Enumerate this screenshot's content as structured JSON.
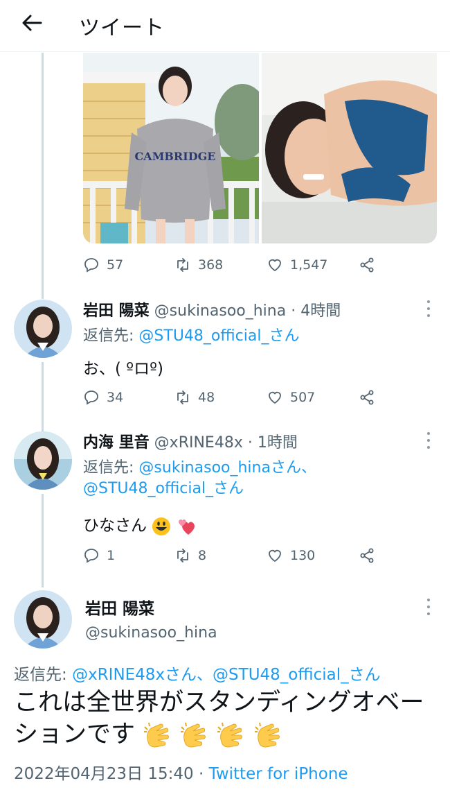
{
  "header": {
    "title": "ツイート"
  },
  "top_tweet": {
    "stats": {
      "replies": "57",
      "retweets": "368",
      "likes": "1,547"
    }
  },
  "replies": [
    {
      "display_name": "岩田 陽菜",
      "handle_time": "@sukinasoo_hina · 4時間",
      "reply_label": "返信先:",
      "reply_mentions": "@STU48_official_さん",
      "text": "お、( ºロº)",
      "stats": {
        "replies": "34",
        "retweets": "48",
        "likes": "507"
      }
    },
    {
      "display_name": "内海 里音",
      "handle_time": "@xRINE48x · 1時間",
      "reply_label": "返信先:",
      "reply_mentions_line1": "@sukinasoo_hinaさん、",
      "reply_mentions_line2": "@STU48_official_さん",
      "text": "ひなさん",
      "stats": {
        "replies": "1",
        "retweets": "8",
        "likes": "130"
      }
    }
  ],
  "main_tweet": {
    "display_name": "岩田 陽菜",
    "handle": "@sukinasoo_hina",
    "reply_label": "返信先:",
    "reply_mentions": "@xRINE48xさん、@STU48_official_さん",
    "text": "これは全世界がスタンディングオベーションです",
    "timestamp": "2022年04月23日 15:40 · ",
    "source": "Twitter for iPhone"
  },
  "colors": {
    "link": "#1d9bf0",
    "secondary_text": "#536471",
    "thread_line": "#cfd9de"
  }
}
